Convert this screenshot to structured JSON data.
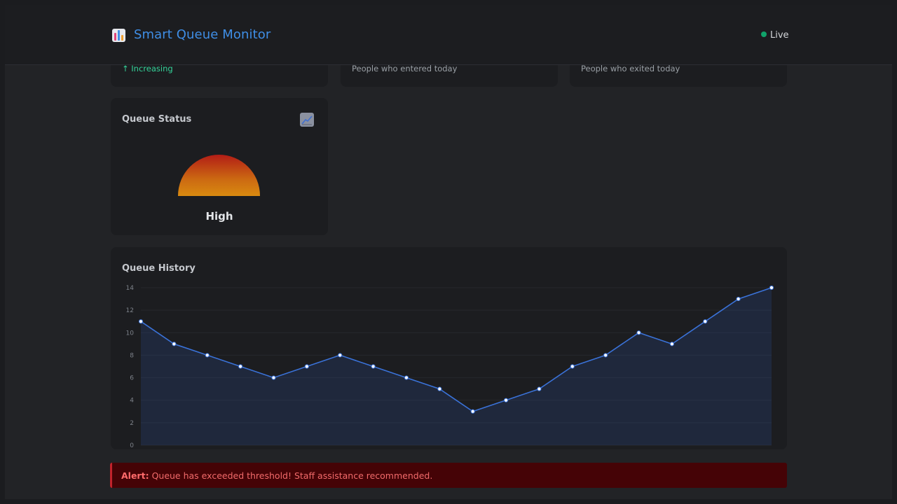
{
  "header": {
    "app_icon": "bar-chart-icon",
    "title": "Smart Queue Monitor",
    "live_label": "Live",
    "live_color": "#10a36a"
  },
  "stats": [
    {
      "subtext": "↑ Increasing",
      "trend": "up"
    },
    {
      "subtext": "People who entered today"
    },
    {
      "subtext": "People who exited today"
    }
  ],
  "queue_status": {
    "title": "Queue Status",
    "chart_icon": "line-chart-icon",
    "level": "High"
  },
  "queue_history": {
    "title": "Queue History"
  },
  "chart_data": {
    "type": "area",
    "title": "Queue History",
    "x": [
      1,
      2,
      3,
      4,
      5,
      6,
      7,
      8,
      9,
      10,
      11,
      12,
      13,
      14,
      15,
      16,
      17,
      18,
      19,
      20
    ],
    "values": [
      11,
      9,
      8,
      7,
      6,
      7,
      8,
      7,
      6,
      5,
      3,
      4,
      5,
      7,
      8,
      10,
      9,
      11,
      13,
      14
    ],
    "ylim": [
      0,
      14
    ],
    "yticks": [
      0,
      2,
      4,
      6,
      8,
      10,
      12,
      14
    ],
    "grid": true,
    "line_color": "#3a72d8"
  },
  "alert": {
    "label": "Alert:",
    "message": "Queue has exceeded threshold! Staff assistance recommended."
  }
}
